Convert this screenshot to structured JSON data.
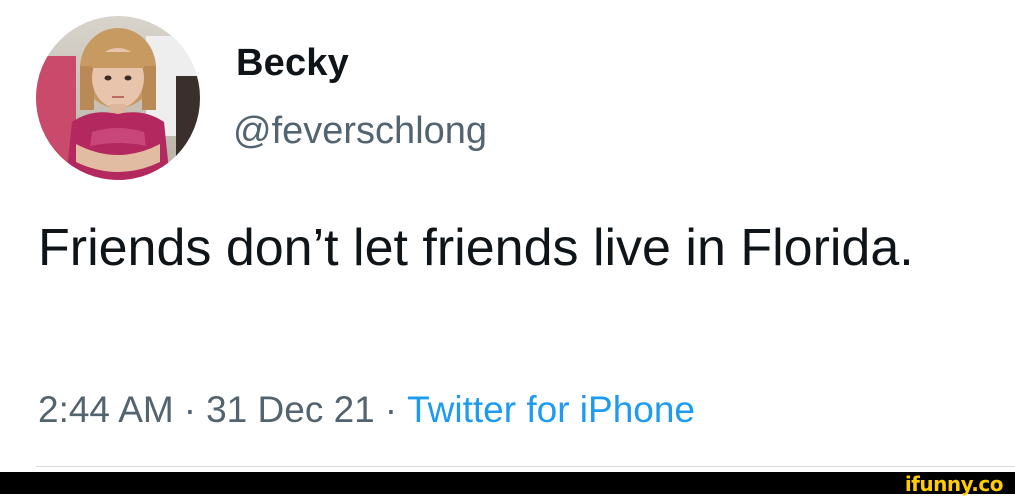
{
  "tweet": {
    "author": {
      "display_name": "Becky",
      "handle": "@feverschlong",
      "avatar": "profile-photo"
    },
    "text": "Friends don’t let friends live in Florida.",
    "meta": {
      "time": "2:44 AM",
      "separator": "·",
      "date": "31 Dec 21",
      "source": "Twitter for iPhone"
    }
  },
  "watermark": {
    "text": "ifunny.co"
  },
  "colors": {
    "text_primary": "#0f1419",
    "text_secondary": "#536471",
    "link": "#1d9bf0",
    "footer_bar": "#000000",
    "watermark": "#ffcc00"
  }
}
